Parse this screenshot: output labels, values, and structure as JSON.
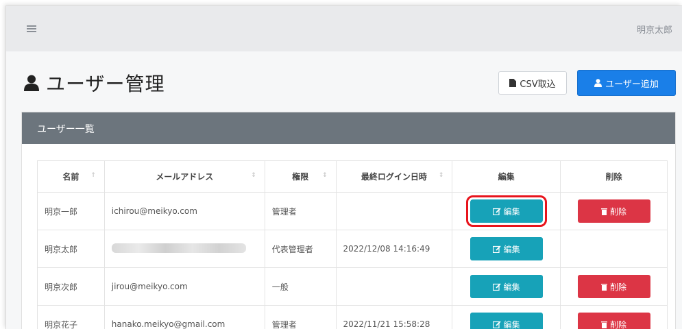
{
  "header": {
    "username": "明京太郎"
  },
  "page": {
    "title": "ユーザー管理"
  },
  "toolbar": {
    "csv_label": "CSV取込",
    "add_label": "ユーザー追加"
  },
  "card": {
    "title": "ユーザー一覧"
  },
  "table": {
    "columns": [
      "名前",
      "メールアドレス",
      "権限",
      "最終ログイン日時",
      "編集",
      "削除"
    ],
    "rows": [
      {
        "name": "明京一郎",
        "email": "ichirou@meikyo.com",
        "role": "管理者",
        "last_login": "",
        "edit": "編集",
        "delete": "削除"
      },
      {
        "name": "明京太郎",
        "email": "",
        "role": "代表管理者",
        "last_login": "2022/12/08 14:16:49",
        "edit": "編集",
        "delete": ""
      },
      {
        "name": "明京次郎",
        "email": "jirou@meikyo.com",
        "role": "一般",
        "last_login": "",
        "edit": "編集",
        "delete": "削除"
      },
      {
        "name": "明京花子",
        "email": "hanako.meikyo@gmail.com",
        "role": "管理者",
        "last_login": "2022/11/21 15:58:28",
        "edit": "編集",
        "delete": "削除"
      }
    ]
  },
  "colors": {
    "edit": "#17a2b8",
    "delete": "#dc3545",
    "primary": "#1a7fe8",
    "card_header": "#6c757d",
    "highlight": "#e8141c"
  },
  "icons": {
    "menu": "hamburger-icon",
    "title": "user-icon",
    "csv": "file-icon",
    "add": "user-icon",
    "edit": "edit-icon",
    "delete": "trash-icon"
  }
}
